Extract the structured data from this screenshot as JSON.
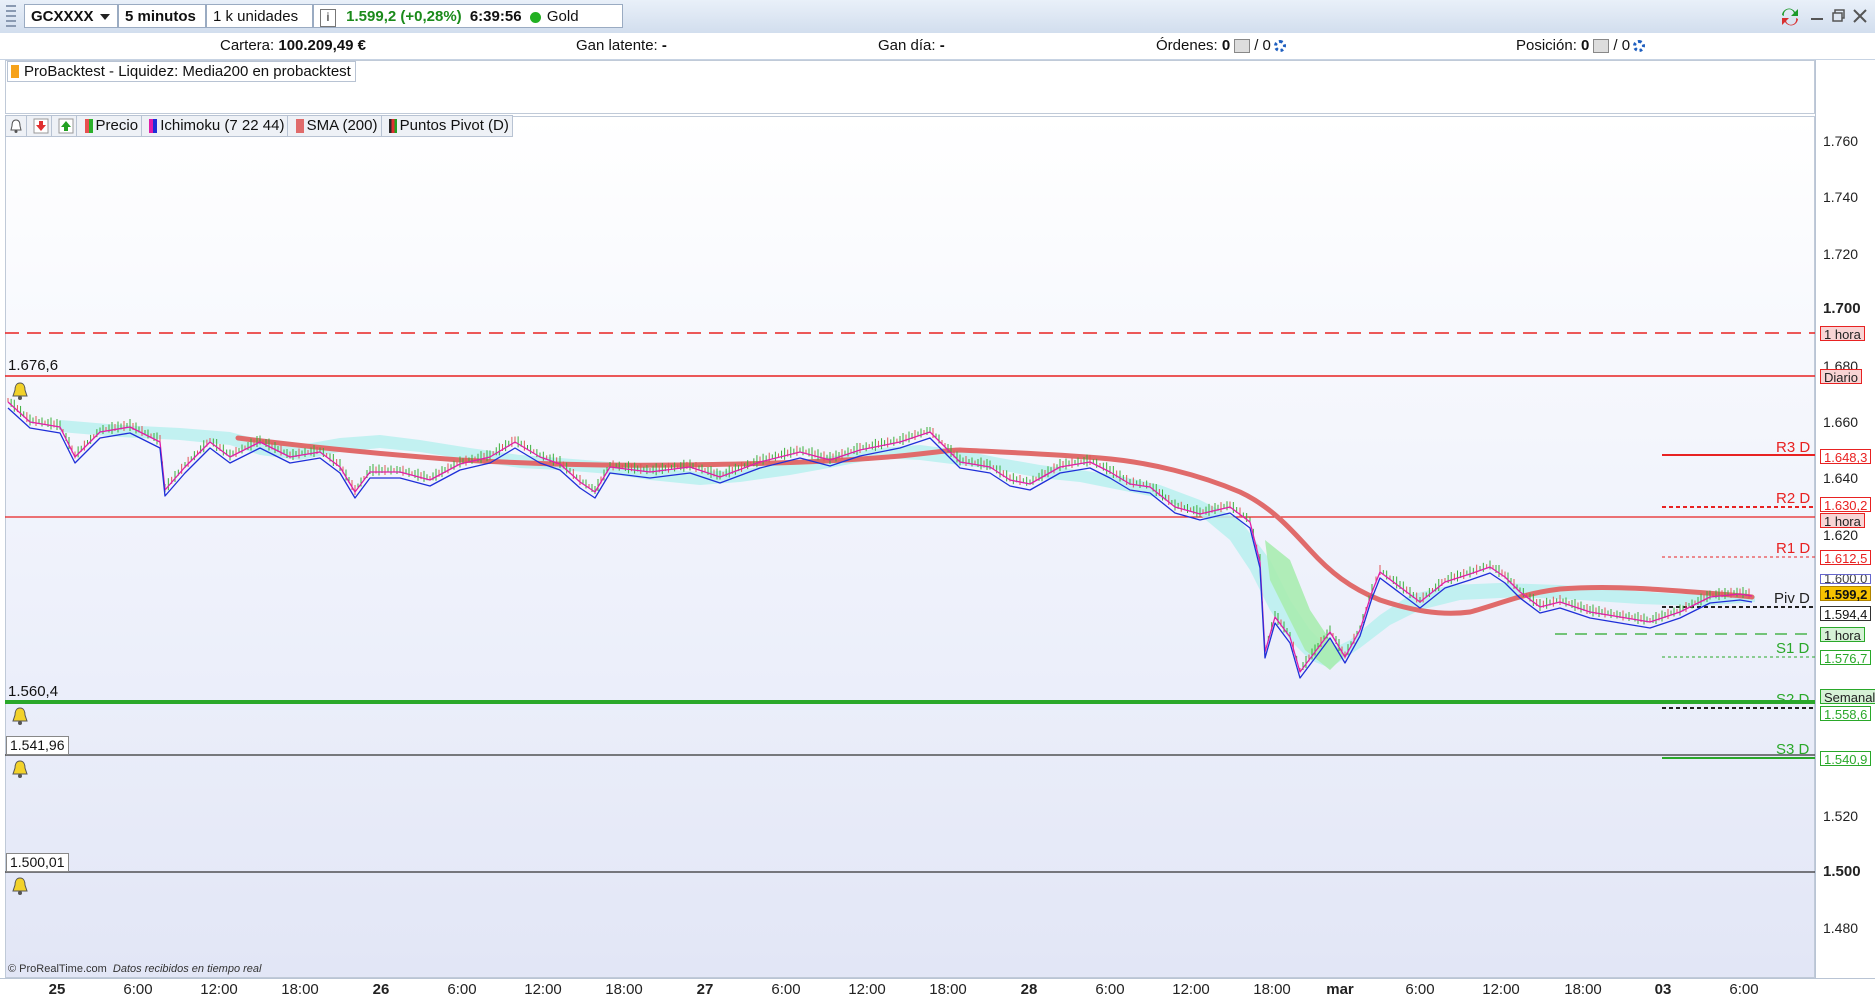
{
  "toolbar": {
    "symbol": "GCXXXX",
    "timeframe": "5 minutos",
    "units": "1 k unidades",
    "info_icon": "i",
    "price_change": "1.599,2 (+0,28%)",
    "time": "6:39:56",
    "instrument": "Gold Full0420"
  },
  "portfolio": {
    "cartera_label": "Cartera:",
    "cartera_value": "100.209,49 €",
    "gan_latente_label": "Gan latente:",
    "gan_latente_value": "-",
    "gan_dia_label": "Gan día:",
    "gan_dia_value": "-",
    "ordenes_label": "Órdenes:",
    "ordenes_value": "0",
    "ordenes_value2": "/ 0",
    "posicion_label": "Posición:",
    "posicion_value": "0",
    "posicion_value2": "/ 0"
  },
  "top_pane": {
    "label": "ProBacktest - Liquidez: Media200 en probacktest"
  },
  "legend": {
    "precio": "Precio",
    "ichimoku": "Ichimoku (7 22 44)",
    "sma": "SMA (200)",
    "pivots": "Puntos Pivot (D)"
  },
  "levels_left": {
    "l1": "1.676,6",
    "l2": "1.560,4",
    "l3": "1.541,96",
    "l4": "1.500,01"
  },
  "pivot_labels": {
    "r3": "R3 D",
    "r2": "R2 D",
    "r1": "R1 D",
    "piv": "Piv D",
    "s1": "S1 D",
    "s2": "S2 D",
    "s3": "S3 D"
  },
  "axis_tags": {
    "hora1": "1 hora",
    "diario": "Diario",
    "r3": "1.648,3",
    "r2": "1.630,2",
    "hora2": "1 hora",
    "r1": "1.612,5",
    "partial": "1.600,0",
    "price": "1.599,2",
    "piv": "1.594,4",
    "hora3": "1 hora",
    "s1": "1.576,7",
    "semanal": "Semanal",
    "s2": "1.558,6",
    "s3": "1.540,9"
  },
  "y_ticks": [
    "1.760",
    "1.740",
    "1.720",
    "1.700",
    "1.680",
    "1.660",
    "1.640",
    "1.620",
    "1.520",
    "1.500",
    "1.480"
  ],
  "x_ticks": [
    "25",
    "6:00",
    "12:00",
    "18:00",
    "26",
    "6:00",
    "12:00",
    "18:00",
    "27",
    "6:00",
    "12:00",
    "18:00",
    "28",
    "6:00",
    "12:00",
    "18:00",
    "mar",
    "6:00",
    "12:00",
    "18:00",
    "03",
    "6:00"
  ],
  "footer": {
    "brand": "© ProRealTime.com",
    "note": "Datos recibidos en tiempo real"
  },
  "colors": {
    "sma": "#e06b6b",
    "cloud": "#b9f0ee",
    "cloud2": "#a8ecb0",
    "kijun": "#1f2fd8",
    "tenkan": "#e01ea8",
    "resistance": "#e82222",
    "support": "#2aa82a"
  }
}
